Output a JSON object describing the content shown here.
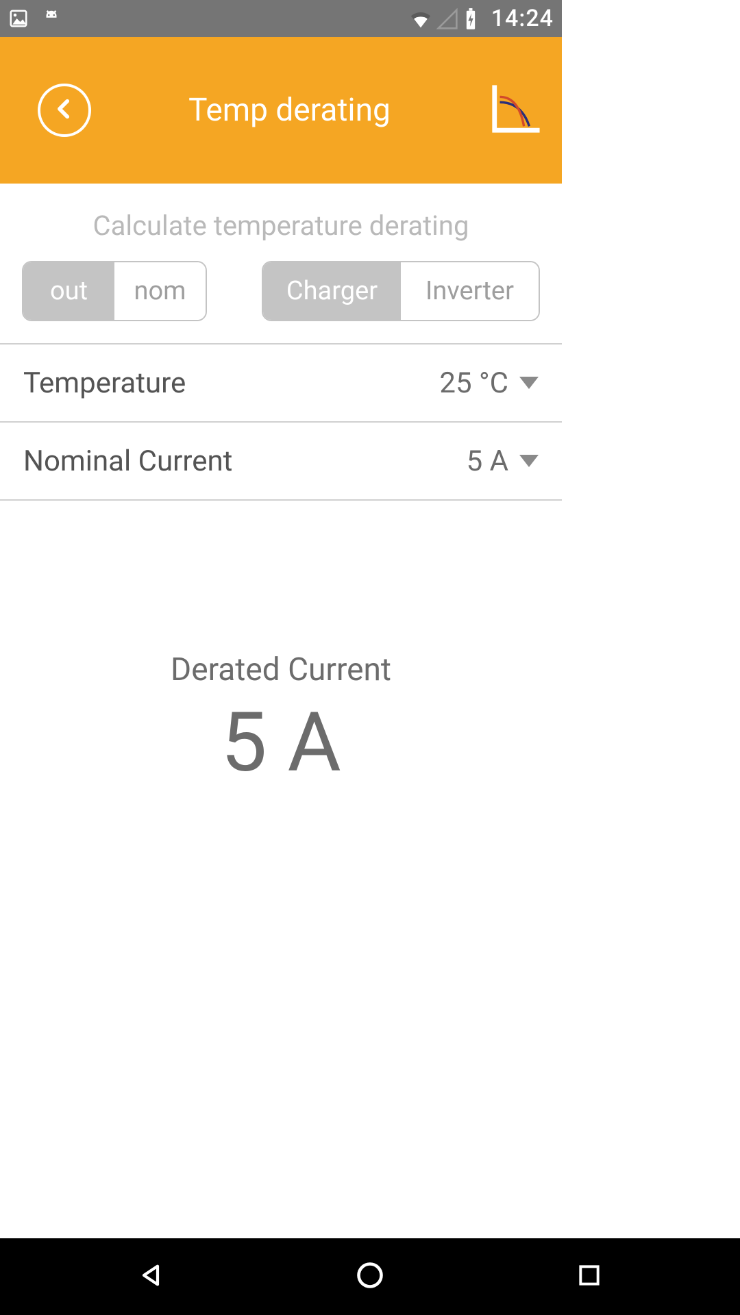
{
  "status_bar": {
    "time": "14:24"
  },
  "header": {
    "title": "Temp derating"
  },
  "subtitle": "Calculate temperature derating",
  "segments": {
    "group1": {
      "option_a": "out",
      "option_b": "nom",
      "active": "a"
    },
    "group2": {
      "option_a": "Charger",
      "option_b": "Inverter",
      "active": "a"
    }
  },
  "settings": {
    "temperature": {
      "label": "Temperature",
      "value": "25 °C"
    },
    "nominal_current": {
      "label": "Nominal Current",
      "value": "5 A"
    }
  },
  "result": {
    "label": "Derated Current",
    "value": "5 A"
  }
}
